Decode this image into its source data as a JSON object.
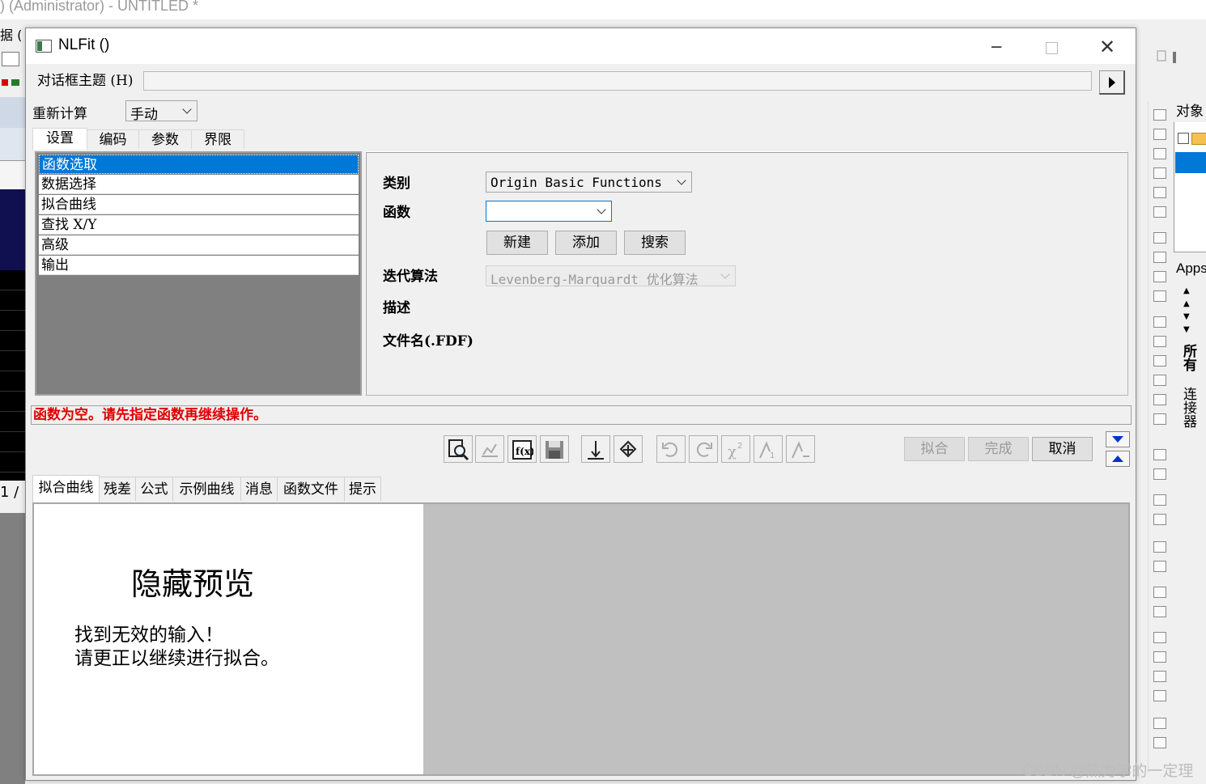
{
  "background_app": {
    "title": ") (Administrator) - UNTITLED *",
    "left_label": "据 (",
    "sheet_fragment": "1 /",
    "object_manager_label": "对象",
    "apps_label": "Apps",
    "vertical_tabs": [
      "所有",
      "连接器"
    ]
  },
  "dialog": {
    "title": "NLFit ()",
    "theme_label": "对话框主题 (H)",
    "theme_value": "",
    "recalc_label": "重新计算",
    "recalc_value": "手动",
    "tabs": [
      "设置",
      "编码",
      "参数",
      "界限"
    ],
    "settings_list": [
      "函数选取",
      "数据选择",
      "拟合曲线",
      "查找 X/Y",
      "高级",
      "输出"
    ],
    "selected_item": "函数选取",
    "form": {
      "category_label": "类别",
      "category_value": "Origin Basic Functions",
      "function_label": "函数",
      "function_value": "",
      "buttons": [
        "新建",
        "添加",
        "搜索"
      ],
      "algorithm_label": "迭代算法",
      "algorithm_value": "Levenberg-Marquardt 优化算法",
      "description_label": "描述",
      "filename_label": "文件名(.FDF)"
    },
    "status_message": "函数为空。请先指定函数再继续操作。",
    "action_buttons": {
      "fit": "拟合",
      "done": "完成",
      "cancel": "取消"
    },
    "bottom_tabs": [
      "拟合曲线",
      "残差",
      "公式",
      "示例曲线",
      "消息",
      "函数文件",
      "提示"
    ],
    "preview": {
      "title": "隐藏预览",
      "message_line1": "找到无效的输入！",
      "message_line2": "请更正以继续进行拟合。"
    }
  },
  "watermark": "CSDN @热力学的一定理"
}
